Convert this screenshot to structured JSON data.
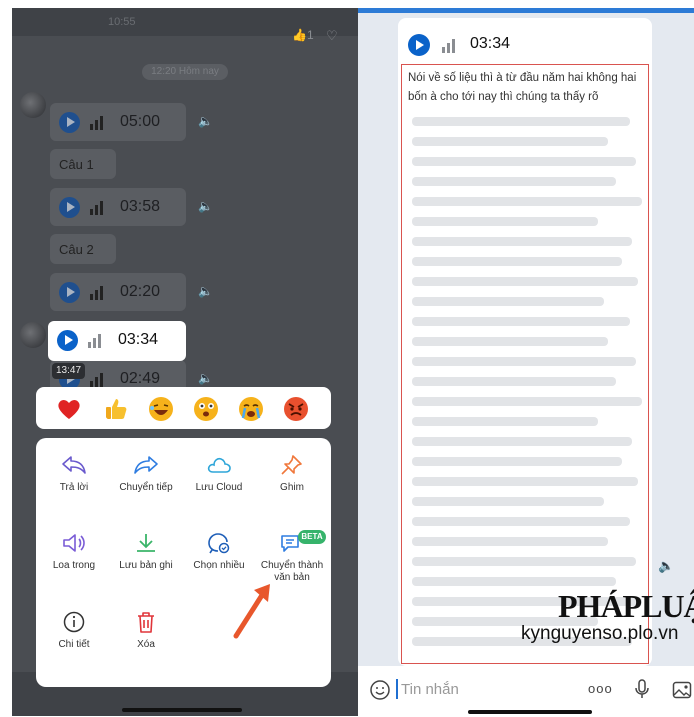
{
  "left": {
    "top_time": "10:55",
    "top_like_count": "1",
    "date_divider": "12:20 Hôm nay",
    "messages": [
      {
        "type": "voice",
        "duration": "05:00"
      },
      {
        "type": "text",
        "text": "Câu 1"
      },
      {
        "type": "voice",
        "duration": "03:58"
      },
      {
        "type": "text",
        "text": "Câu 2"
      },
      {
        "type": "voice",
        "duration": "02:20"
      },
      {
        "type": "voice",
        "duration": "02:49"
      }
    ],
    "focused": {
      "duration": "03:34",
      "time": "13:47"
    },
    "reactions": [
      "heart-emoji",
      "thumbs-up-emoji",
      "laugh-emoji",
      "surprised-emoji",
      "crying-emoji",
      "angry-emoji"
    ],
    "menu": {
      "items": [
        {
          "label": "Trả lời",
          "icon": "reply-icon"
        },
        {
          "label": "Chuyển tiếp",
          "icon": "forward-icon"
        },
        {
          "label": "Lưu Cloud",
          "icon": "cloud-icon"
        },
        {
          "label": "Ghim",
          "icon": "pin-icon"
        },
        {
          "label": "Loa trong",
          "icon": "speaker-icon"
        },
        {
          "label": "Lưu bản ghi",
          "icon": "download-icon"
        },
        {
          "label": "Chọn nhiều",
          "icon": "multi-select-icon"
        },
        {
          "label": "Chuyển thành văn bản",
          "icon": "speech-to-text-icon"
        },
        {
          "label": "Chi tiết",
          "icon": "info-icon"
        },
        {
          "label": "Xóa",
          "icon": "trash-icon"
        }
      ],
      "beta_badge": "BETA"
    }
  },
  "right": {
    "voice": {
      "duration": "03:34"
    },
    "transcript": "Nói về số liệu thì à từ đầu năm hai không hai bốn à cho tới nay thì chúng ta thấy rõ",
    "watermark": {
      "brand": "PHÁPLUẬT",
      "site": "kynguyenso.plo.vn"
    },
    "input": {
      "placeholder": "Tin nhắn",
      "more": "ooo"
    }
  },
  "colors": {
    "accent": "#0a62c9",
    "highlight_box": "#d9534f",
    "beta": "#36b36b",
    "arrow": "#e8572c"
  }
}
